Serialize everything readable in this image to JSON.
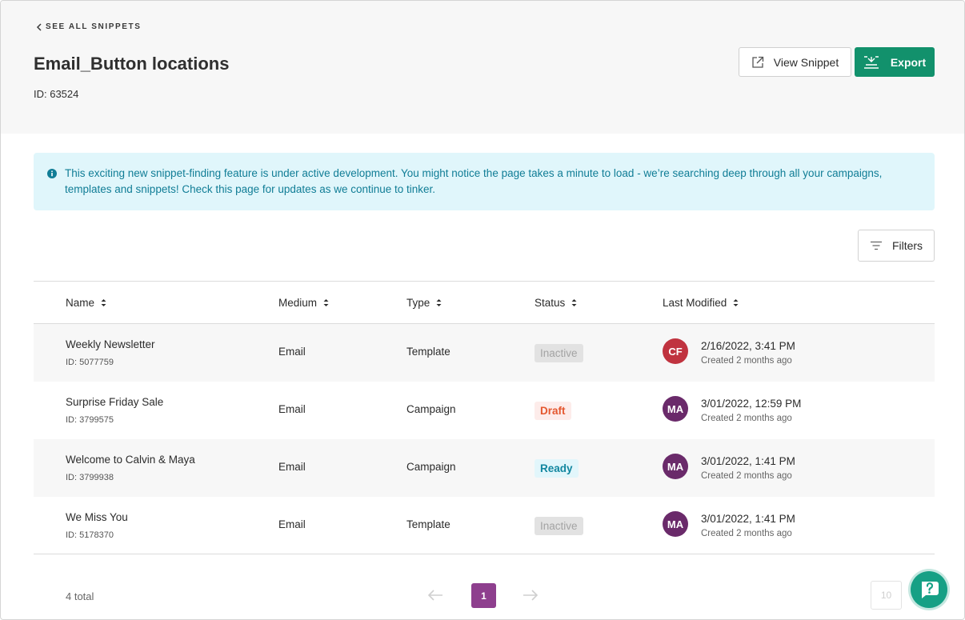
{
  "header": {
    "back_label": "SEE ALL SNIPPETS",
    "title": "Email_Button locations",
    "id_text": "ID: 63524",
    "view_snippet_label": "View Snippet",
    "export_label": "Export"
  },
  "notice": {
    "icon": "info-icon",
    "text": "This exciting new snippet-finding feature is under active development. You might notice the page takes a minute to load - we’re searching deep through all your campaigns, templates and snippets! Check this page for updates as we continue to tinker."
  },
  "filters_label": "Filters",
  "table": {
    "columns": [
      "Name",
      "Medium",
      "Type",
      "Status",
      "Last Modified"
    ],
    "rows": [
      {
        "name": "Weekly Newsletter",
        "id": "ID: 5077759",
        "medium": "Email",
        "type": "Template",
        "status": "Inactive",
        "status_kind": "inactive",
        "initials": "CF",
        "avatar_color": "#c0333f",
        "modified": "2/16/2022, 3:41 PM",
        "created": "Created 2 months ago"
      },
      {
        "name": "Surprise Friday Sale",
        "id": "ID: 3799575",
        "medium": "Email",
        "type": "Campaign",
        "status": "Draft",
        "status_kind": "draft",
        "initials": "MA",
        "avatar_color": "#6a2a6a",
        "modified": "3/01/2022, 12:59 PM",
        "created": "Created 2 months ago"
      },
      {
        "name": "Welcome to Calvin & Maya",
        "id": "ID: 3799938",
        "medium": "Email",
        "type": "Campaign",
        "status": "Ready",
        "status_kind": "ready",
        "initials": "MA",
        "avatar_color": "#6a2a6a",
        "modified": "3/01/2022, 1:41 PM",
        "created": "Created 2 months ago"
      },
      {
        "name": "We Miss You",
        "id": "ID: 5178370",
        "medium": "Email",
        "type": "Template",
        "status": "Inactive",
        "status_kind": "inactive",
        "initials": "MA",
        "avatar_color": "#6a2a6a",
        "modified": "3/01/2022, 1:41 PM",
        "created": "Created 2 months ago"
      }
    ]
  },
  "footer": {
    "total": "4 total",
    "current_page": "1",
    "per_page": "10"
  },
  "colors": {
    "export_green": "#12916c",
    "page_active": "#8e3f8e",
    "notice_bg": "#e0f6fb",
    "notice_text": "#107d96"
  }
}
